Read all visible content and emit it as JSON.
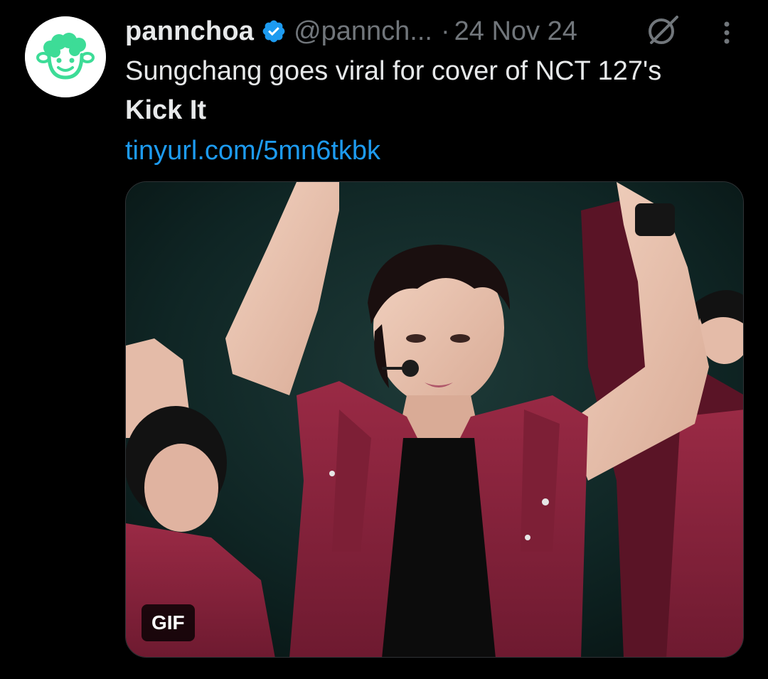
{
  "tweet": {
    "author_name": "pannchoa",
    "handle": "@pannch...",
    "separator": "·",
    "date": "24 Nov 24",
    "text_line1": "Sungchang goes viral for cover of NCT 127's",
    "text_line2": "Kick It",
    "link": "tinyurl.com/5mn6tkbk",
    "media_badge": "GIF"
  },
  "icons": {
    "avatar": "sheep-smiley-logo",
    "verified": "verified-badge-icon",
    "grok": "grok-icon",
    "more": "more-vertical-icon"
  },
  "colors": {
    "background": "#000000",
    "text": "#e7e9ea",
    "muted": "#71767b",
    "link": "#1d9bf0",
    "avatar_accent": "#3ddc97"
  }
}
